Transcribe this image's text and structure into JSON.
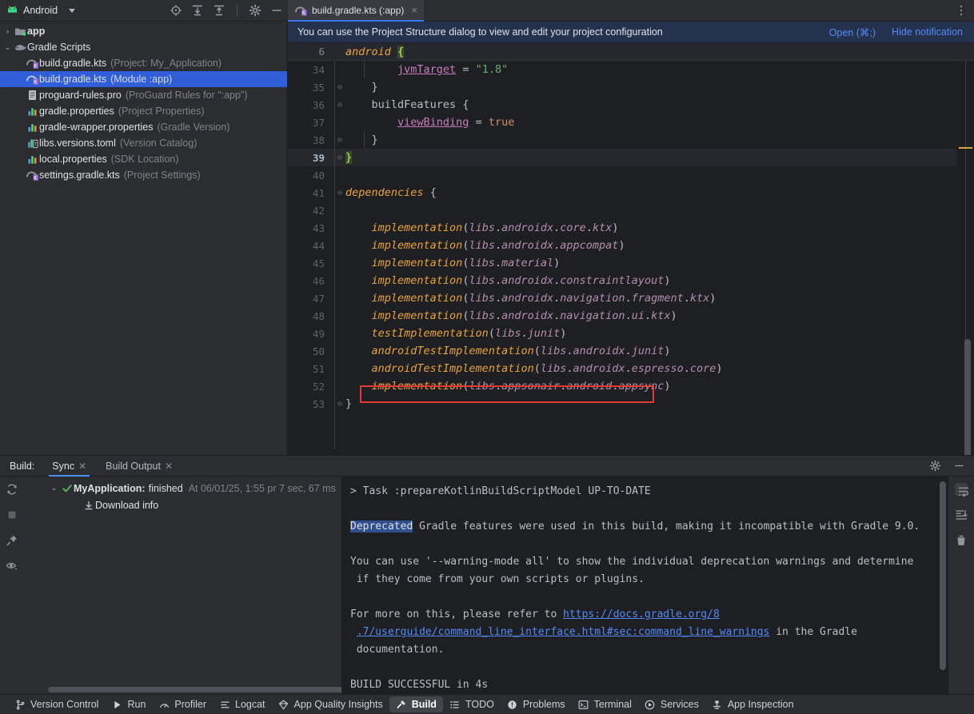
{
  "project_panel": {
    "title": "Android",
    "dropdown_icon": "chevron-down-icon",
    "toolbar_icons": [
      "select-opened-file-icon",
      "expand-all-icon",
      "collapse-all-icon",
      "settings-gear-icon",
      "minimize-icon"
    ],
    "tree": [
      {
        "arrow": "›",
        "icon": "module-folder-icon",
        "label": "app",
        "sub": "",
        "bold": true,
        "indent": 0,
        "selected": false
      },
      {
        "arrow": "⌄",
        "icon": "gradle-elephant-icon",
        "label": "Gradle Scripts",
        "sub": "",
        "bold": false,
        "indent": 0,
        "selected": false
      },
      {
        "arrow": "",
        "icon": "gradle-kts-file-icon",
        "label": "build.gradle.kts",
        "sub": "(Project: My_Application)",
        "bold": false,
        "indent": 1,
        "selected": false
      },
      {
        "arrow": "",
        "icon": "gradle-kts-file-icon",
        "label": "build.gradle.kts",
        "sub": "(Module :app)",
        "bold": false,
        "indent": 1,
        "selected": true
      },
      {
        "arrow": "",
        "icon": "text-file-icon",
        "label": "proguard-rules.pro",
        "sub": "(ProGuard Rules for \":app\")",
        "bold": false,
        "indent": 1,
        "selected": false
      },
      {
        "arrow": "",
        "icon": "properties-file-icon",
        "label": "gradle.properties",
        "sub": "(Project Properties)",
        "bold": false,
        "indent": 1,
        "selected": false
      },
      {
        "arrow": "",
        "icon": "properties-file-icon",
        "label": "gradle-wrapper.properties",
        "sub": "(Gradle Version)",
        "bold": false,
        "indent": 1,
        "selected": false
      },
      {
        "arrow": "",
        "icon": "toml-file-icon",
        "label": "libs.versions.toml",
        "sub": "(Version Catalog)",
        "bold": false,
        "indent": 1,
        "selected": false
      },
      {
        "arrow": "",
        "icon": "properties-file-icon",
        "label": "local.properties",
        "sub": "(SDK Location)",
        "bold": false,
        "indent": 1,
        "selected": false
      },
      {
        "arrow": "",
        "icon": "gradle-kts-file-icon",
        "label": "settings.gradle.kts",
        "sub": "(Project Settings)",
        "bold": false,
        "indent": 1,
        "selected": false
      }
    ]
  },
  "editor": {
    "tab": {
      "label": "build.gradle.kts (:app)",
      "icon": "gradle-kts-file-icon",
      "close": "×"
    },
    "kebab_icon": "more-options-icon",
    "notification": {
      "message": "You can use the Project Structure dialog to view and edit your project configuration",
      "open_link": "Open (⌘;)",
      "hide_link": "Hide notification"
    },
    "sticky_header": {
      "line": "6",
      "text": "android {"
    },
    "warning_icon": "warning-triangle-icon",
    "lines": [
      {
        "num": "34",
        "fold": "",
        "current": false
      },
      {
        "num": "35",
        "fold": "⊖",
        "current": false
      },
      {
        "num": "36",
        "fold": "⊖",
        "current": false
      },
      {
        "num": "37",
        "fold": "",
        "current": false
      },
      {
        "num": "38",
        "fold": "⊖",
        "current": false
      },
      {
        "num": "39",
        "fold": "⊖",
        "current": true
      },
      {
        "num": "40",
        "fold": "",
        "current": false
      },
      {
        "num": "41",
        "fold": "⊖",
        "current": false
      },
      {
        "num": "42",
        "fold": "",
        "current": false
      },
      {
        "num": "43",
        "fold": "",
        "current": false
      },
      {
        "num": "44",
        "fold": "",
        "current": false
      },
      {
        "num": "45",
        "fold": "",
        "current": false
      },
      {
        "num": "46",
        "fold": "",
        "current": false
      },
      {
        "num": "47",
        "fold": "",
        "current": false
      },
      {
        "num": "48",
        "fold": "",
        "current": false
      },
      {
        "num": "49",
        "fold": "",
        "current": false
      },
      {
        "num": "50",
        "fold": "",
        "current": false
      },
      {
        "num": "51",
        "fold": "",
        "current": false
      },
      {
        "num": "52",
        "fold": "",
        "current": false
      },
      {
        "num": "53",
        "fold": "⊖",
        "current": false
      }
    ],
    "code_text": [
      "        jvmTarget = \"1.8\"",
      "    }",
      "    buildFeatures {",
      "        viewBinding = true",
      "    }",
      "}",
      "",
      "dependencies {",
      "",
      "    implementation(libs.androidx.core.ktx)",
      "    implementation(libs.androidx.appcompat)",
      "    implementation(libs.material)",
      "    implementation(libs.androidx.constraintlayout)",
      "    implementation(libs.androidx.navigation.fragment.ktx)",
      "    implementation(libs.androidx.navigation.ui.ktx)",
      "    testImplementation(libs.junit)",
      "    androidTestImplementation(libs.androidx.junit)",
      "    androidTestImplementation(libs.androidx.espresso.core)",
      "    implementation(libs.appsonair.android.appsync)",
      "}"
    ],
    "highlighted_line": "implementation(libs.appsonair.android.appsync)",
    "highlight_color": "#e53935"
  },
  "build_panel": {
    "label": "Build:",
    "tabs": [
      {
        "label": "Sync",
        "closable": true,
        "active": true
      },
      {
        "label": "Build Output",
        "closable": true,
        "active": false
      }
    ],
    "header_icons": [
      "settings-gear-icon",
      "minimize-icon"
    ],
    "left_rail_icons": [
      "restart-sync-icon",
      "stop-icon",
      "pin-icon",
      "eye-icon"
    ],
    "right_rail_icons": [
      "soft-wrap-icon",
      "scroll-to-end-icon",
      "trash-icon"
    ],
    "tree": {
      "status_icon": "success-check-icon",
      "arrow": "⌄",
      "name": "MyApplication:",
      "state": "finished",
      "time": "At 06/01/25, 1:55 pr 7 sec, 67 ms",
      "child_icon": "download-icon",
      "child_label": "Download info"
    },
    "console": [
      {
        "text": "> Task :prepareKotlinBuildScriptModel UP-TO-DATE",
        "type": "plain"
      },
      {
        "text": "",
        "type": "plain"
      },
      {
        "text": "Deprecated",
        "rest": " Gradle features were used in this build, making it incompatible with Gradle 9.0.",
        "type": "highlight"
      },
      {
        "text": "",
        "type": "plain"
      },
      {
        "text": "You can use '--warning-mode all' to show the individual deprecation warnings and determine",
        "type": "plain"
      },
      {
        "text": " if they come from your own scripts or plugins.",
        "type": "plain"
      },
      {
        "text": "",
        "type": "plain"
      },
      {
        "pre": "For more on this, please refer to ",
        "link": "https://docs.gradle.org/8",
        "type": "link"
      },
      {
        "pre": " ",
        "link": ".7/userguide/command_line_interface.html#sec:command_line_warnings",
        "post": " in the Gradle",
        "type": "link"
      },
      {
        "text": " documentation.",
        "type": "plain"
      },
      {
        "text": "",
        "type": "plain"
      },
      {
        "text": "BUILD SUCCESSFUL in 4s",
        "type": "plain"
      }
    ]
  },
  "statusbar": {
    "items": [
      {
        "label": "Version Control",
        "icon": "branch-icon",
        "active": false
      },
      {
        "label": "Run",
        "icon": "play-icon",
        "active": false
      },
      {
        "label": "Profiler",
        "icon": "profiler-icon",
        "active": false
      },
      {
        "label": "Logcat",
        "icon": "logcat-icon",
        "active": false
      },
      {
        "label": "App Quality Insights",
        "icon": "diamond-icon",
        "active": false
      },
      {
        "label": "Build",
        "icon": "hammer-icon",
        "active": true
      },
      {
        "label": "TODO",
        "icon": "list-icon",
        "active": false
      },
      {
        "label": "Problems",
        "icon": "problems-icon",
        "active": false
      },
      {
        "label": "Terminal",
        "icon": "terminal-icon",
        "active": false
      },
      {
        "label": "Services",
        "icon": "services-icon",
        "active": false
      },
      {
        "label": "App Inspection",
        "icon": "inspection-icon",
        "active": false
      }
    ]
  },
  "colors": {
    "accent_blue": "#3573f0",
    "selection_blue": "#2f5ed8",
    "notification_bg": "#25324d",
    "editor_bg": "#1e1f22",
    "panel_bg": "#2b2d30",
    "highlight_red": "#e53935",
    "success_green": "#5aaa5a"
  }
}
